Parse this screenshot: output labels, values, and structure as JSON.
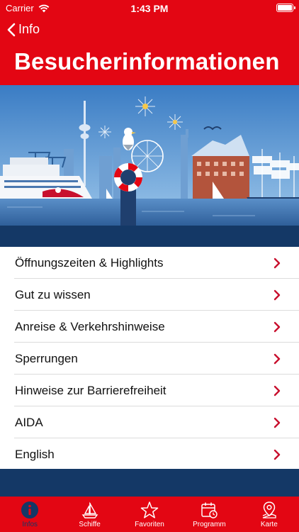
{
  "status_bar": {
    "carrier": "Carrier",
    "time": "1:43 PM"
  },
  "nav": {
    "back_label": "Info",
    "title": "Besucherinformationen"
  },
  "menu": {
    "items": [
      {
        "label": "Öffnungszeiten & Highlights"
      },
      {
        "label": "Gut zu wissen"
      },
      {
        "label": "Anreise & Verkehrshinweise"
      },
      {
        "label": "Sperrungen"
      },
      {
        "label": "Hinweise zur Barrierefreiheit"
      },
      {
        "label": "AIDA"
      },
      {
        "label": "English"
      }
    ]
  },
  "tabbar": {
    "tabs": [
      {
        "label": "Infos",
        "icon": "info-icon"
      },
      {
        "label": "Schiffe",
        "icon": "sailboat-icon"
      },
      {
        "label": "Favoriten",
        "icon": "star-icon"
      },
      {
        "label": "Programm",
        "icon": "calendar-icon"
      },
      {
        "label": "Karte",
        "icon": "map-pin-icon"
      }
    ],
    "active_index": 0
  },
  "colors": {
    "brand_red": "#e30613",
    "navy": "#143866",
    "chevron": "#c8102e"
  }
}
